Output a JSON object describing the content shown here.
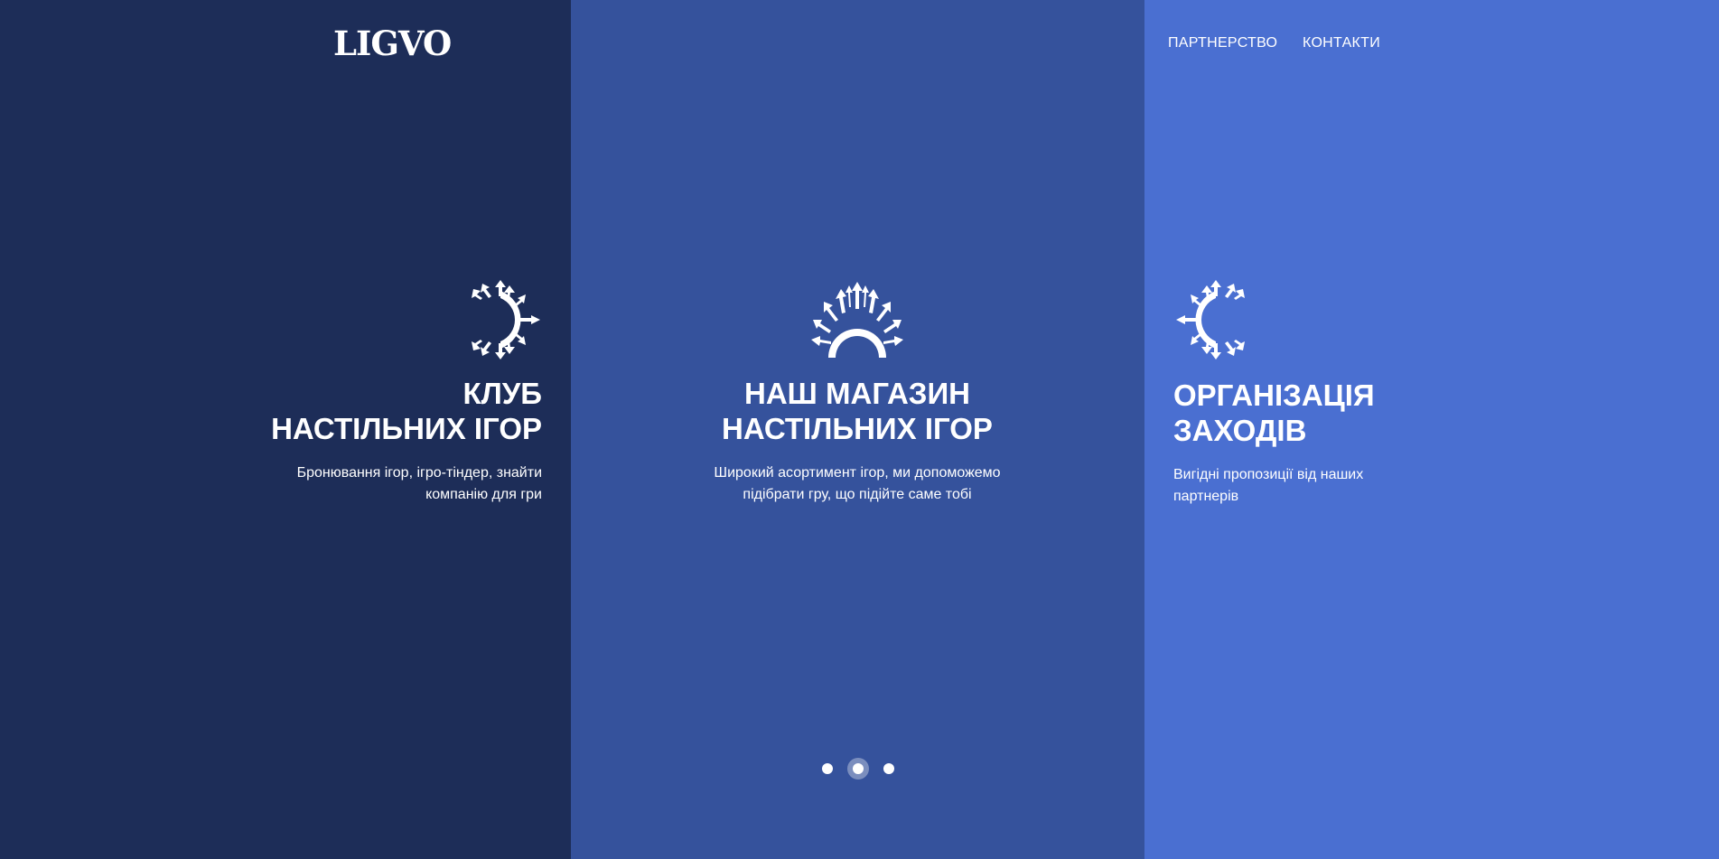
{
  "brand": {
    "logo": "LIGVO"
  },
  "nav": {
    "partnership": "ПАРТНЕРСТВО",
    "contacts": "КОНТАКТИ"
  },
  "panels": [
    {
      "icon": "sun-rays-icon-right",
      "title_line1": "КЛУБ",
      "title_line2": "НАСТІЛЬНИХ ІГОР",
      "description": "Бронювання ігор, ігро-тіндер, знайти компанію для гри",
      "color": "#1d2d58"
    },
    {
      "icon": "sun-rays-icon-up",
      "title_line1": "НАШ МАГАЗИН",
      "title_line2": "НАСТІЛЬНИХ ІГОР",
      "description": "Широкий асортимент ігор, ми допоможемо підібрати гру, що підійте саме тобі",
      "color": "#35529c"
    },
    {
      "icon": "sun-rays-icon-left",
      "title_line1": "ОРГАНІЗАЦІЯ",
      "title_line2": "ЗАХОДІВ",
      "description": "Вигідні пропозиції від наших партнерів",
      "color": "#4a6fd1"
    }
  ],
  "pagination": {
    "count": 3,
    "active": 2
  }
}
